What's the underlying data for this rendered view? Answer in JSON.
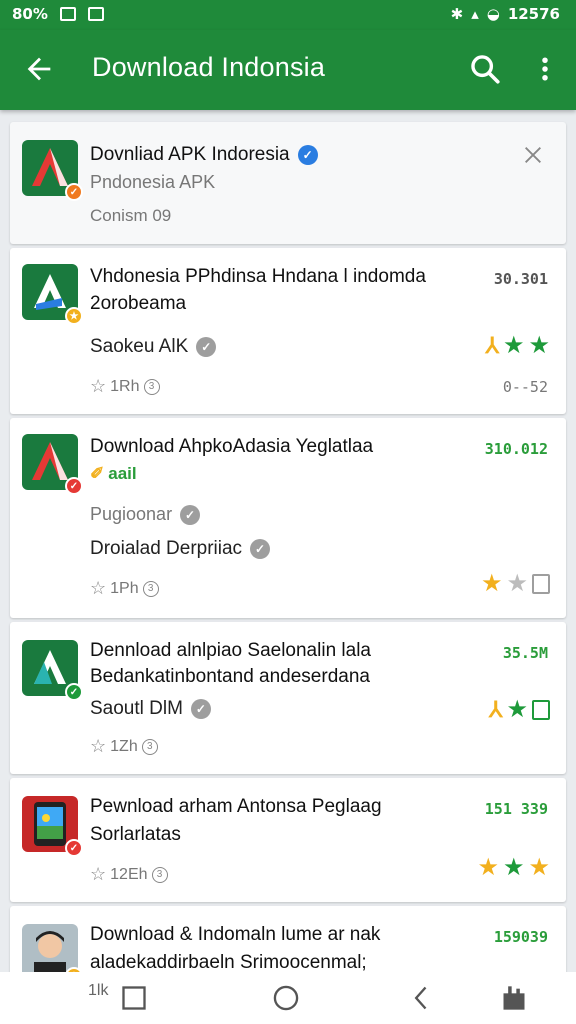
{
  "status_bar": {
    "left": "80%",
    "time": "12576"
  },
  "app_bar": {
    "title": "Download Indonsia"
  },
  "header_card": {
    "title": "Dovnliad APK Indoresia",
    "subtitle": "Pndonesia APK",
    "meta": "Conism 09"
  },
  "apps": [
    {
      "title_line1": "Vhdonesia PPhdinsa Hndana l indomda",
      "title_line2": "2orobeama",
      "developer": "Saokeu AlK",
      "size": "30.301",
      "size2": "0--52",
      "meta": "1Rh",
      "icon": "apk-a-icon",
      "badge_color": "#f2b01e",
      "rating_style": "green-three"
    },
    {
      "title_line1": "Download  AhpkoAdasia Yeglatlaa",
      "tag": "aail",
      "publisher": "Pugioonar",
      "developer": "Droialad Derpriiac",
      "size": "310.012",
      "meta": "1Ph",
      "icon": "apk-a-red-icon",
      "badge_color": "#e53935",
      "rating_style": "gold-grey-box"
    },
    {
      "title_line1": "Dennload alnlpiao Saelonalin lala",
      "title_line2": "Bedankatinbontand andeserdana",
      "developer": "Saoutl DlM",
      "size": "35.5M",
      "meta": "1Zh",
      "icon": "apk-a-teal-icon",
      "badge_color": "#1e9a3a",
      "rating_style": "green-box"
    },
    {
      "title_line1": "Pewnload arham Antonsa Peglaag",
      "title_line2": "Sorlarlatas",
      "size": "151 339",
      "meta": "12Eh",
      "icon": "game-phone-icon",
      "badge_color": "#e53935",
      "rating_style": "gold-green-gold"
    },
    {
      "title_line1": "Download & Indomaln lume ar nak",
      "title_line2": "aladekaddirbaeln Srimoocenmal;",
      "size": "159039",
      "icon": "avatar-man-icon",
      "badge_color": "#f2b01e"
    }
  ],
  "nav_bar": {
    "label": "1lk"
  },
  "colors": {
    "primary": "#1f8a3a",
    "accent_green": "#1e9a3a",
    "star_gold": "#f2b01e",
    "verify_blue": "#2a7de1"
  }
}
